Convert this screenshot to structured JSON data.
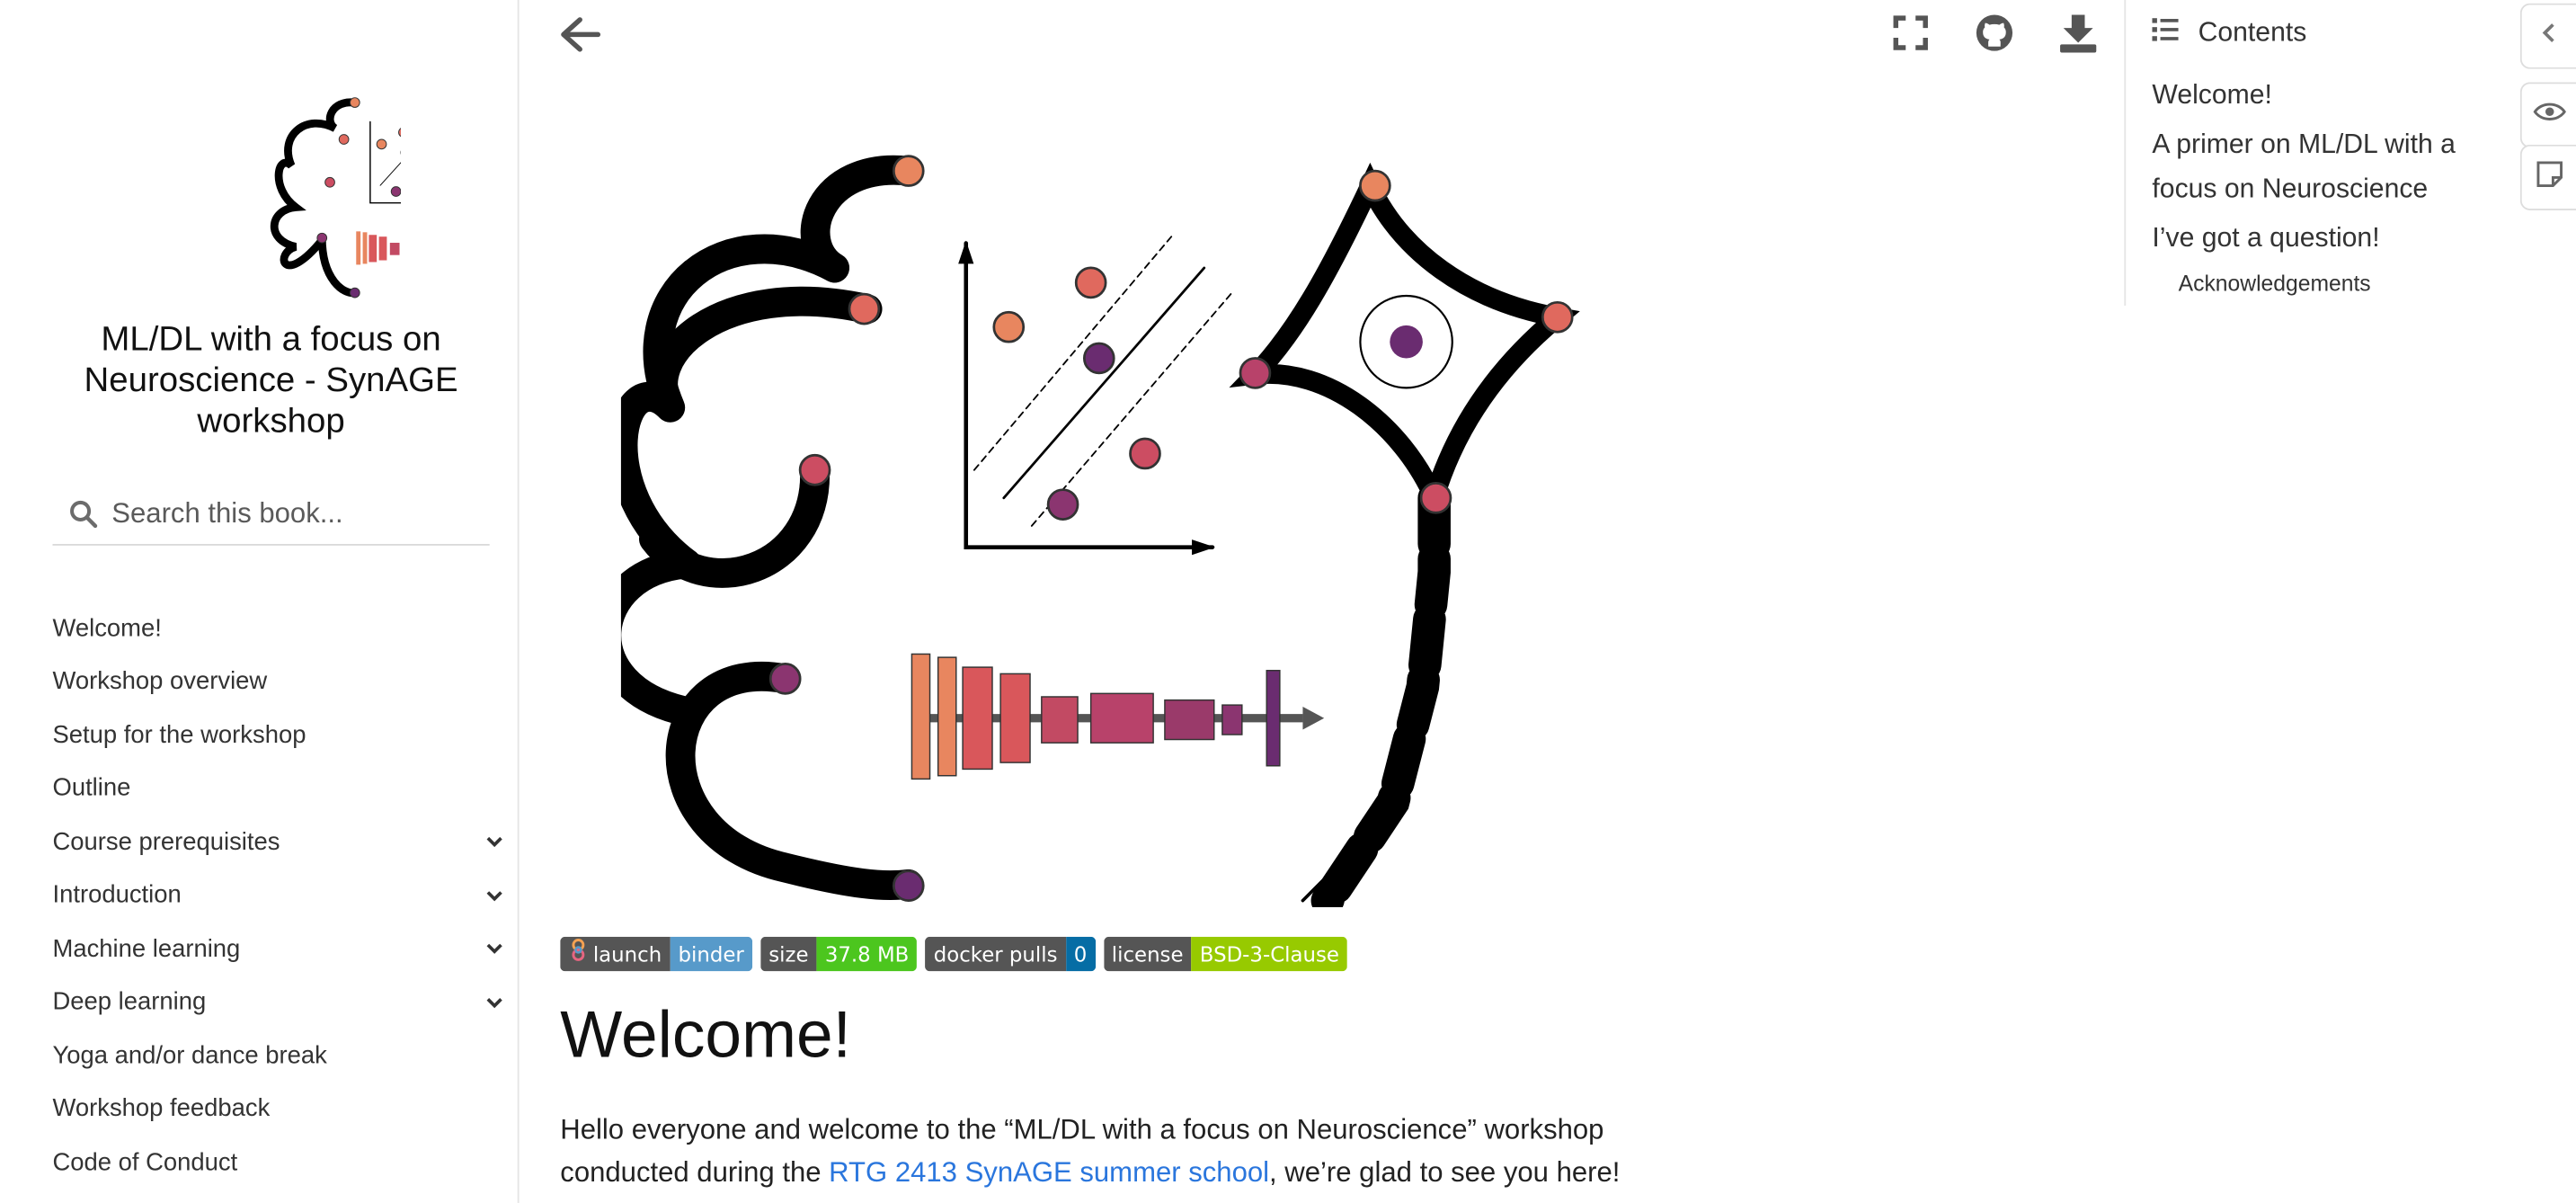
{
  "sidebar": {
    "book_title": "ML/DL with a focus on Neuroscience - SynAGE workshop",
    "search_placeholder": "Search this book...",
    "nav": [
      {
        "label": "Welcome!",
        "expandable": false
      },
      {
        "label": "Workshop overview",
        "expandable": false
      },
      {
        "label": "Setup for the workshop",
        "expandable": false
      },
      {
        "label": "Outline",
        "expandable": false
      },
      {
        "label": "Course prerequisites",
        "expandable": true
      },
      {
        "label": "Introduction",
        "expandable": true
      },
      {
        "label": "Machine learning",
        "expandable": true
      },
      {
        "label": "Deep learning",
        "expandable": true
      },
      {
        "label": "Yoga and/or dance break",
        "expandable": false
      },
      {
        "label": "Workshop feedback",
        "expandable": false
      },
      {
        "label": "Code of Conduct",
        "expandable": false
      }
    ]
  },
  "toolbar": {
    "icons": [
      "arrow-left-icon",
      "fullscreen-icon",
      "github-icon",
      "download-icon"
    ]
  },
  "badges": [
    {
      "left": "launch",
      "right": "binder",
      "color": "#579aca",
      "icon": "binder-logo"
    },
    {
      "left": "size",
      "right": "37.8 MB",
      "color": "#4cc61e"
    },
    {
      "left": "docker pulls",
      "right": "0",
      "color": "#066da5"
    },
    {
      "left": "license",
      "right": "BSD-3-Clause",
      "color": "#97ca00"
    }
  ],
  "content": {
    "heading": "Welcome!",
    "intro_before": "Hello everyone and welcome to the “ML/DL with a focus on Neuroscience” workshop conducted during the ",
    "intro_link": "RTG 2413 SynAGE summer school",
    "intro_after": ", we’re glad to see you here!"
  },
  "toc": {
    "title": "Contents",
    "items": [
      {
        "label": "Welcome!",
        "level": 1
      },
      {
        "label": "A primer on ML/DL with a focus on Neuroscience",
        "level": 1
      },
      {
        "label": "I’ve got a question!",
        "level": 1
      },
      {
        "label": "Acknowledgements",
        "level": 2
      }
    ]
  },
  "colors": {
    "link": "#2a76dd",
    "accent_orange": "#e8865f",
    "accent_red": "#d9575b",
    "accent_magenta": "#b8426a",
    "accent_purple": "#6a2c70"
  }
}
